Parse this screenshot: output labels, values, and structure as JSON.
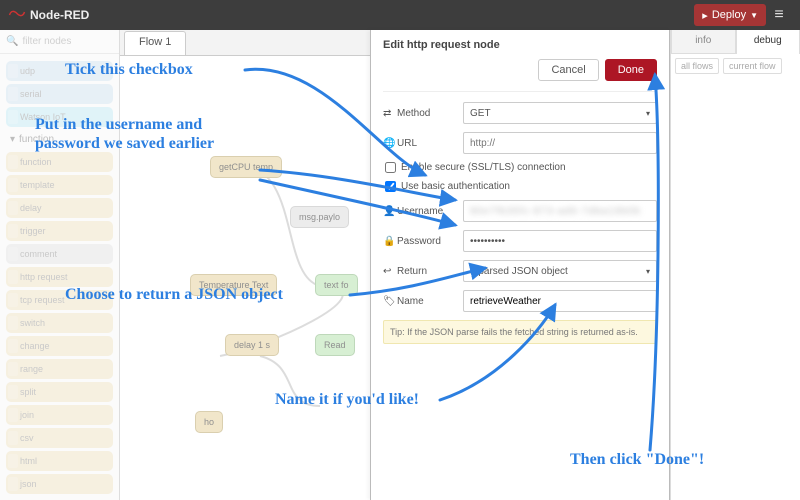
{
  "header": {
    "title": "Node-RED",
    "deploy": "Deploy"
  },
  "palette": {
    "filter_placeholder": "filter nodes",
    "network": [
      "udp",
      "serial",
      "Watson IoT"
    ],
    "group": "function",
    "func": [
      "function",
      "template",
      "delay",
      "trigger",
      "comment",
      "http request",
      "tcp request",
      "switch",
      "change",
      "range",
      "split",
      "join",
      "csv",
      "html",
      "json"
    ]
  },
  "tabs": {
    "flow": "Flow 1"
  },
  "canvasNodes": {
    "cpu": "getCPU temp",
    "msg": "msg.paylo",
    "temp": "Temperature Text",
    "txt": "text fo",
    "delay": "delay 1 s",
    "read": "Read",
    "ho": "ho"
  },
  "infoPanel": {
    "info": "info",
    "debug": "debug",
    "all": "all flows",
    "current": "current flow"
  },
  "dialog": {
    "title": "Edit http request node",
    "cancel": "Cancel",
    "done": "Done",
    "method_label": "Method",
    "method_value": "GET",
    "url_label": "URL",
    "url_placeholder": "http://",
    "ssl_label": "Enable secure (SSL/TLS) connection",
    "auth_label": "Use basic authentication",
    "user_label": "Username",
    "user_value": "90e7fb35fc-873-ad6-7dba19b0b",
    "pass_label": "Password",
    "pass_value": "••••••••••",
    "return_label": "Return",
    "return_value": "a parsed JSON object",
    "name_label": "Name",
    "name_value": "retrieveWeather",
    "tip": "Tip: If the JSON parse fails the fetched string is returned as-is."
  },
  "annotations": {
    "tick": "Tick this checkbox",
    "creds": "Put in the username and password we saved earlier",
    "json": "Choose to return a JSON object",
    "name": "Name it if you'd like!",
    "done": "Then click \"Done\"!"
  }
}
